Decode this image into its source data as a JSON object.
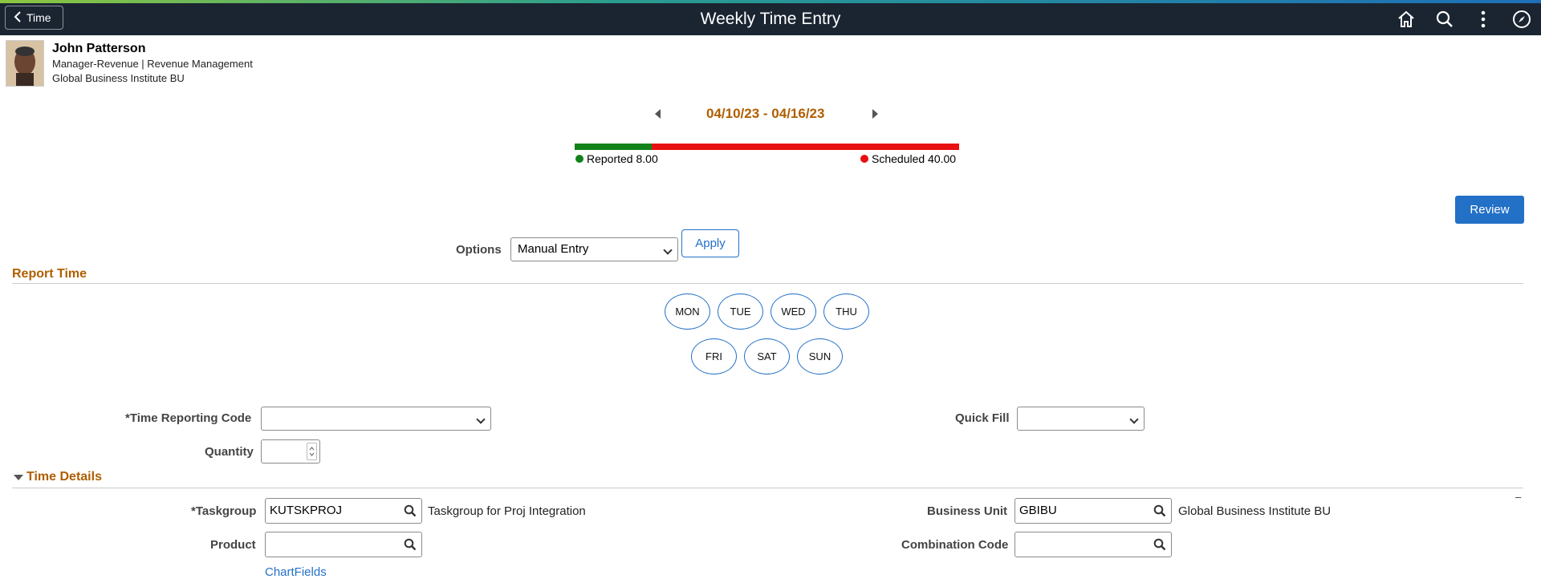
{
  "header": {
    "back_label": "Time",
    "title": "Weekly Time Entry",
    "icons": [
      "home-icon",
      "search-icon",
      "more-vert-icon",
      "navigator-icon"
    ]
  },
  "profile": {
    "name": "John Patterson",
    "title_line": "Manager-Revenue | Revenue Management",
    "business_unit": "Global Business Institute BU"
  },
  "period": {
    "range": "04/10/23 - 04/16/23",
    "reported_label": "Reported 8.00",
    "scheduled_label": "Scheduled 40.00",
    "reported_hours": 8,
    "scheduled_hours": 40,
    "reported_color": "#11821a",
    "scheduled_color": "#e81010"
  },
  "actions": {
    "review_label": "Review",
    "apply_label": "Apply"
  },
  "options": {
    "label": "Options",
    "selected": "Manual Entry"
  },
  "report_time": {
    "title": "Report Time",
    "days": [
      "MON",
      "TUE",
      "WED",
      "THU",
      "FRI",
      "SAT",
      "SUN"
    ],
    "trc_label": "*Time Reporting Code",
    "trc_value": "",
    "quick_fill_label": "Quick Fill",
    "quick_fill_value": "",
    "quantity_label": "Quantity",
    "quantity_value": ""
  },
  "time_details": {
    "title": "Time Details",
    "collapse_label": "–",
    "taskgroup_label": "*Taskgroup",
    "taskgroup_value": "KUTSKPROJ",
    "taskgroup_desc": "Taskgroup for Proj Integration",
    "business_unit_label": "Business Unit",
    "business_unit_value": "GBIBU",
    "business_unit_desc": "Global Business Institute BU",
    "product_label": "Product",
    "product_value": "",
    "combination_code_label": "Combination Code",
    "combination_code_value": "",
    "chartfields_link": "ChartFields"
  },
  "colors": {
    "accent": "#2370c7",
    "section_title": "#b05e00",
    "header_bg": "#1b2532"
  }
}
